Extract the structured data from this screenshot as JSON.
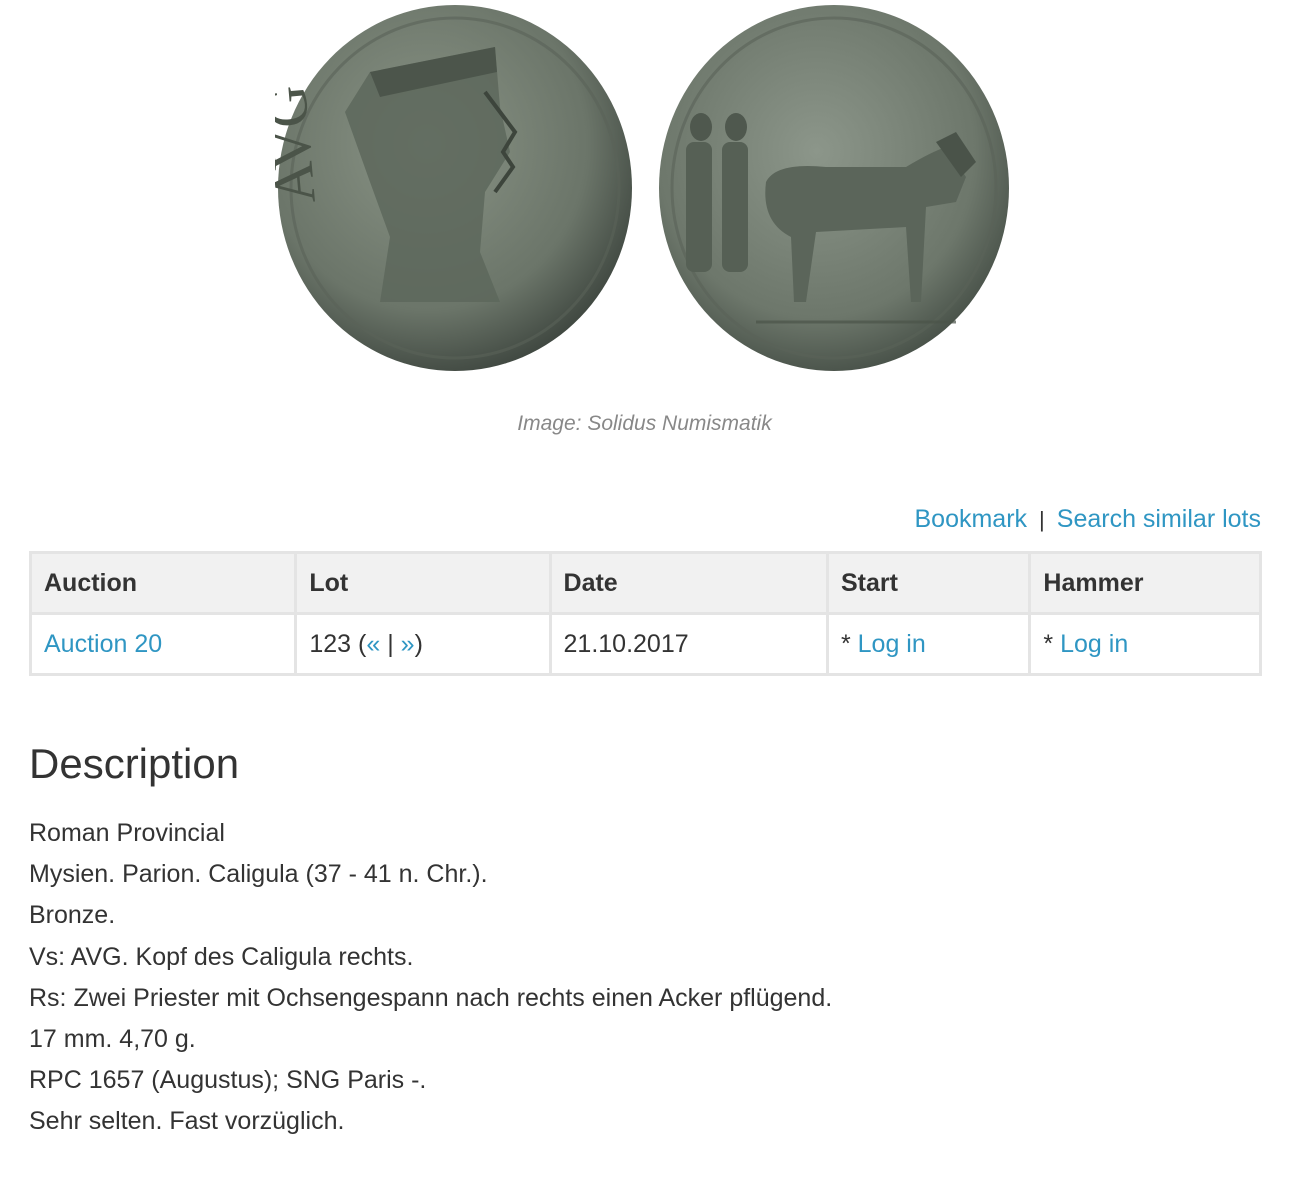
{
  "images": {
    "obverse": {
      "icon": "coin-obverse-image",
      "legend": "AVG"
    },
    "reverse": {
      "icon": "coin-reverse-image"
    },
    "caption": "Image: Solidus Numismatik"
  },
  "actions": {
    "bookmark": "Bookmark",
    "separator": "|",
    "search_similar": "Search similar lots"
  },
  "table": {
    "headers": [
      "Auction",
      "Lot",
      "Date",
      "Start",
      "Hammer"
    ],
    "row": {
      "auction": "Auction 20",
      "lot_number": "123",
      "lot_open": "(",
      "lot_prev": "«",
      "lot_sep": "|",
      "lot_next": "»",
      "lot_close": ")",
      "date": "21.10.2017",
      "start_prefix": "*",
      "start_link": "Log in",
      "hammer_prefix": "*",
      "hammer_link": "Log in"
    }
  },
  "description": {
    "title": "Description",
    "lines": [
      "Roman Provincial",
      "Mysien. Parion. Caligula (37 - 41 n. Chr.).",
      "Bronze.",
      "Vs: AVG. Kopf des Caligula rechts.",
      "Rs: Zwei Priester mit Ochsengespann nach rechts einen Acker pflügend.",
      "17 mm. 4,70 g.",
      "RPC 1657 (Augustus); SNG Paris -.",
      "Sehr selten. Fast vorzüglich."
    ]
  },
  "colors": {
    "link": "#2f96c3",
    "coin_patina": "#6f7a6e"
  }
}
